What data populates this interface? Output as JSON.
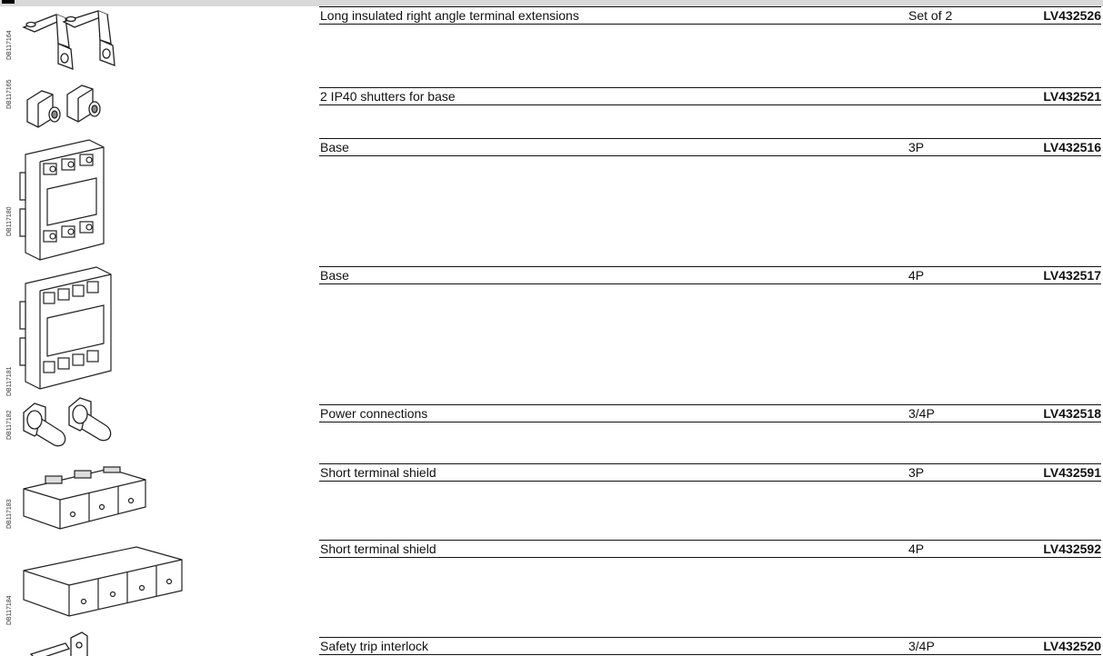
{
  "codes": [
    "DB117164",
    "DB117165",
    "DB117180",
    "DB117181",
    "DB117182",
    "DB117183",
    "DB117184"
  ],
  "items": [
    {
      "description": "Long insulated right angle terminal extensions",
      "qty": "Set of 2",
      "ref": "LV432526"
    },
    {
      "description": "2 IP40 shutters for base",
      "qty": "",
      "ref": "LV432521"
    },
    {
      "description": "Base",
      "qty": "3P",
      "ref": "LV432516"
    },
    {
      "description": "Base",
      "qty": "4P",
      "ref": "LV432517"
    },
    {
      "description": "Power connections",
      "qty": "3/4P",
      "ref": "LV432518"
    },
    {
      "description": "Short terminal shield",
      "qty": "3P",
      "ref": "LV432591"
    },
    {
      "description": "Short terminal shield",
      "qty": "4P",
      "ref": "LV432592"
    },
    {
      "description": "Safety trip interlock",
      "qty": "3/4P",
      "ref": "LV432520"
    }
  ]
}
